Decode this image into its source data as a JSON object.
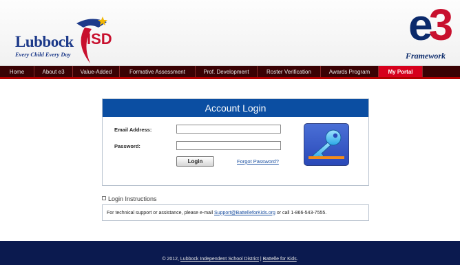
{
  "header": {
    "lisd_logo_word": "Lubbock",
    "lisd_logo_isd": "ISD",
    "lisd_tagline": "Every Child Every Day",
    "e3_logo_e": "e",
    "e3_logo_3": "3",
    "e3_logo_sub": "Framework"
  },
  "nav": {
    "items": [
      {
        "label": "Home"
      },
      {
        "label": "About e3"
      },
      {
        "label": "Value-Added"
      },
      {
        "label": "Formative Assessment"
      },
      {
        "label": "Prof. Development"
      },
      {
        "label": "Roster Verification"
      },
      {
        "label": "Awards Program"
      },
      {
        "label": "My Portal"
      }
    ],
    "active_color": "#d6001c"
  },
  "login": {
    "title": "Account Login",
    "email_label": "Email Address:",
    "email_value": "",
    "password_label": "Password:",
    "password_value": "",
    "login_button": "Login",
    "forgot_link": "Forgot Password?",
    "key_icon": "key-icon"
  },
  "instructions": {
    "heading": "Login Instructions",
    "text_before": "For technical support or assistance, please e-mail",
    "email_link": "Support@BattelleforKids.org",
    "text_after": "or call 1-866-543-7555."
  },
  "footer": {
    "copyright": "© 2012,",
    "district_link": "Lubbock Independent School District",
    "separator": "|",
    "battelle_link": "Battelle for Kids",
    "end": "."
  },
  "colors": {
    "brand_blue": "#0b4ea2",
    "nav_dark": "#3a0204",
    "footer_navy": "#0b1a4f",
    "accent_red": "#c8102e"
  }
}
